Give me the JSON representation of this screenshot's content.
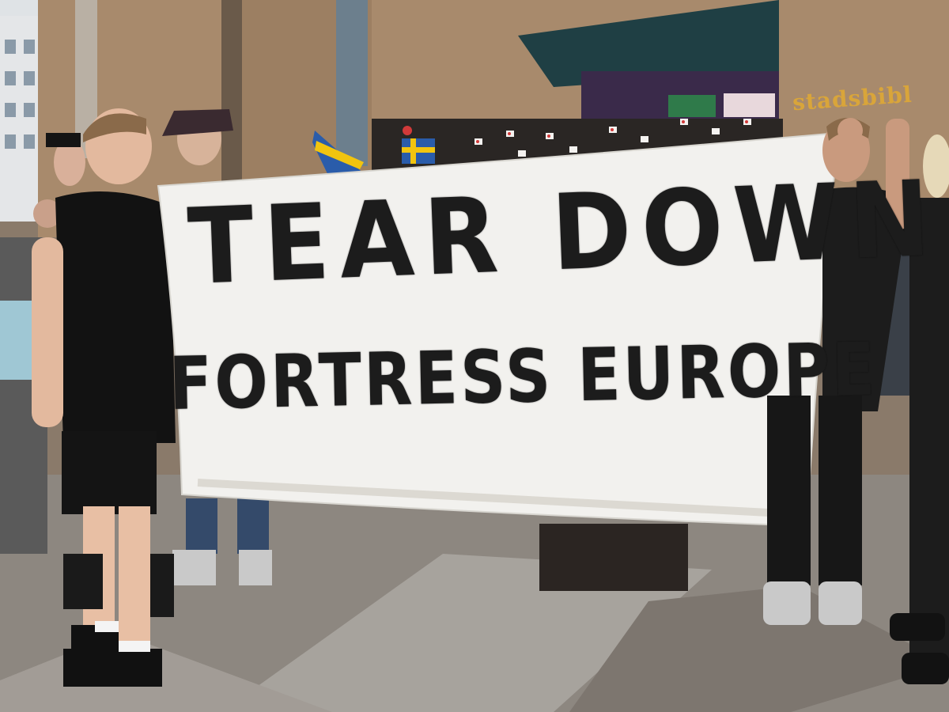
{
  "banner": {
    "line1": "TEAR DOWN",
    "line2": "FORTRESS EUROPE"
  },
  "building_sign": {
    "text": "stadsbibl"
  },
  "colors": {
    "brick": "#a88a6c",
    "banner": "#f2f1ee",
    "ink": "#1c1c1c",
    "pavement": "#8d8780",
    "sign_gold": "#d9a53a"
  }
}
